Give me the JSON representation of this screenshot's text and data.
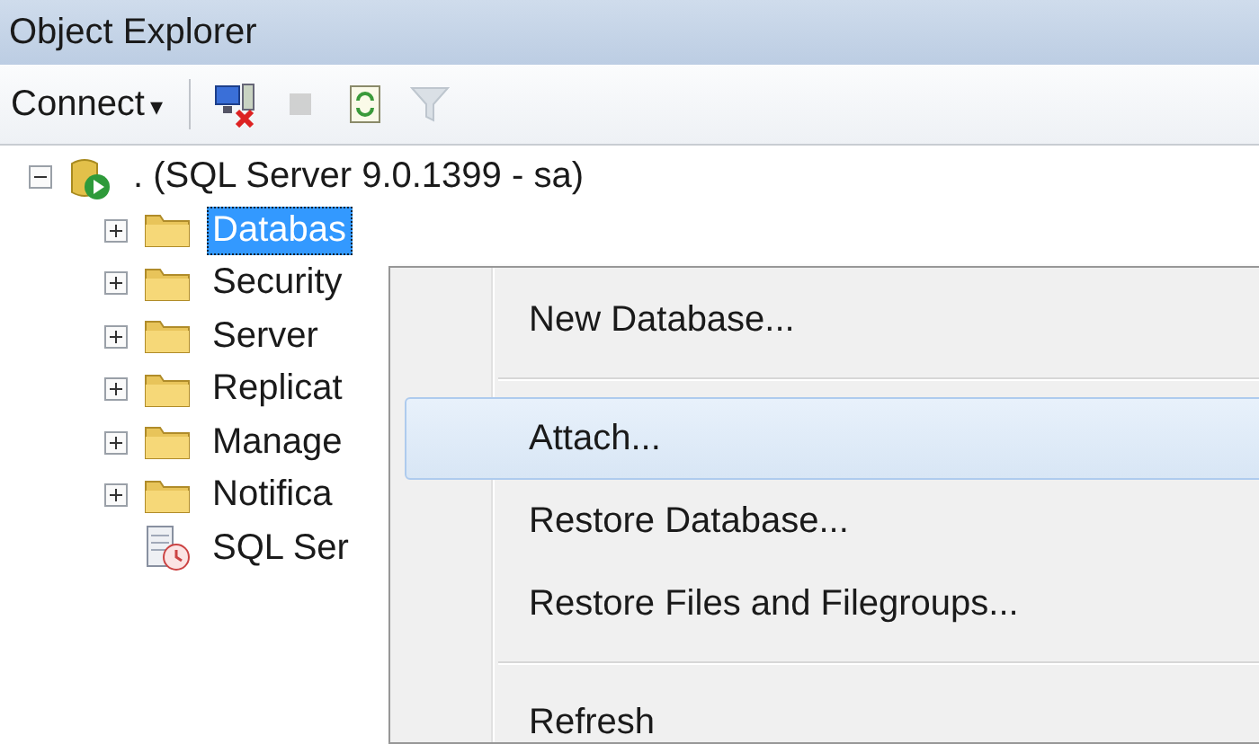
{
  "window": {
    "title": "Object Explorer"
  },
  "toolbar": {
    "connect": {
      "label": "Connect",
      "caret": "▾"
    },
    "buttons": [
      {
        "kind": "disconnect",
        "disabled": false
      },
      {
        "kind": "stop",
        "disabled": true
      },
      {
        "kind": "refresh",
        "disabled": false
      },
      {
        "kind": "filter",
        "disabled": true
      }
    ]
  },
  "tree": [
    {
      "label": ". (SQL Server 9.0.1399 - sa)",
      "kind": "server",
      "expanded": true,
      "selected": false,
      "children": [
        {
          "label": "Databas",
          "kind": "folder",
          "expanded": false,
          "selected": true
        },
        {
          "label": "Security",
          "kind": "folder",
          "expanded": false,
          "selected": false
        },
        {
          "label": "Server",
          "kind": "folder",
          "expanded": false,
          "selected": false
        },
        {
          "label": "Replicat",
          "kind": "folder",
          "expanded": false,
          "selected": false
        },
        {
          "label": "Manage",
          "kind": "folder",
          "expanded": false,
          "selected": false
        },
        {
          "label": "Notifica",
          "kind": "folder",
          "expanded": false,
          "selected": false
        },
        {
          "label": "SQL Ser",
          "kind": "agent",
          "selected": false
        }
      ]
    }
  ],
  "context_menu": [
    {
      "kind": "item",
      "label": "New Database...",
      "selected": false
    },
    {
      "kind": "separator"
    },
    {
      "kind": "item",
      "label": "Attach...",
      "selected": true
    },
    {
      "kind": "item",
      "label": "Restore Database...",
      "selected": false
    },
    {
      "kind": "item",
      "label": "Restore Files and Filegroups...",
      "selected": false
    },
    {
      "kind": "separator"
    },
    {
      "kind": "item",
      "label": "Refresh",
      "selected": false
    }
  ]
}
